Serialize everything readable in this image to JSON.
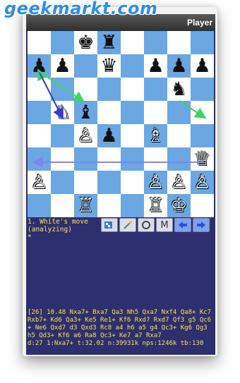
{
  "watermark": "geekmarkt.com",
  "titlebar": {
    "player_label": "Player"
  },
  "board": [
    [
      "",
      "",
      "♚",
      "♜",
      "",
      "",
      "",
      ""
    ],
    [
      "♟",
      "♟",
      "",
      "♛",
      "",
      "♟",
      "♟",
      "♟"
    ],
    [
      "",
      "",
      "",
      "",
      "",
      "",
      "♞",
      ""
    ],
    [
      "",
      "♘",
      "♝",
      "",
      "",
      "",
      "",
      ""
    ],
    [
      "",
      "",
      "♙",
      "♟",
      "",
      "♗",
      "",
      ""
    ],
    [
      "",
      "",
      "",
      "",
      "",
      "",
      "",
      "♕"
    ],
    [
      "♙",
      "",
      "",
      "",
      "",
      "♙",
      "♙",
      "♙"
    ],
    [
      "",
      "",
      "♖",
      "",
      "",
      "♖",
      "♔",
      ""
    ]
  ],
  "colors": {
    "dark_square": "#6aa7e3",
    "light_square": "#ffffff",
    "text": "#ffe14a",
    "background": "#2e2f6e"
  },
  "status": {
    "line1": "1. White's move",
    "line2": "(analyzing)",
    "line3": "*"
  },
  "toolbar": {
    "icons": [
      "flip-board-icon",
      "magic-wand-icon",
      "cycle-icon",
      "menu-m-icon",
      "back-arrow-icon",
      "forward-arrow-icon"
    ],
    "m_label": "M"
  },
  "analysis": {
    "pv": "[26] 10.48 Nxa7+ Bxa7 Qa3 Nh5 Qxa7 Nxf4 Qa8+ Kc7 Rxb7+ Kd6 Qa3+ Ke5 Re1+ Kf6 Rxd7 Rxd7 Qf3 g5 Qc6+ Ne6 Qxd7 d3 Qxd3 Rc8 a4 h6 a5 g4 Qc3+ Kg6 Qg3 h5 Qd3+ Kf6 a6 Ra8 Qc3+ Ke7 a7 Rxa7",
    "stats": "d:27 1:Nxa7+ t:32.02 n:39931k nps:1246k tb:130"
  }
}
